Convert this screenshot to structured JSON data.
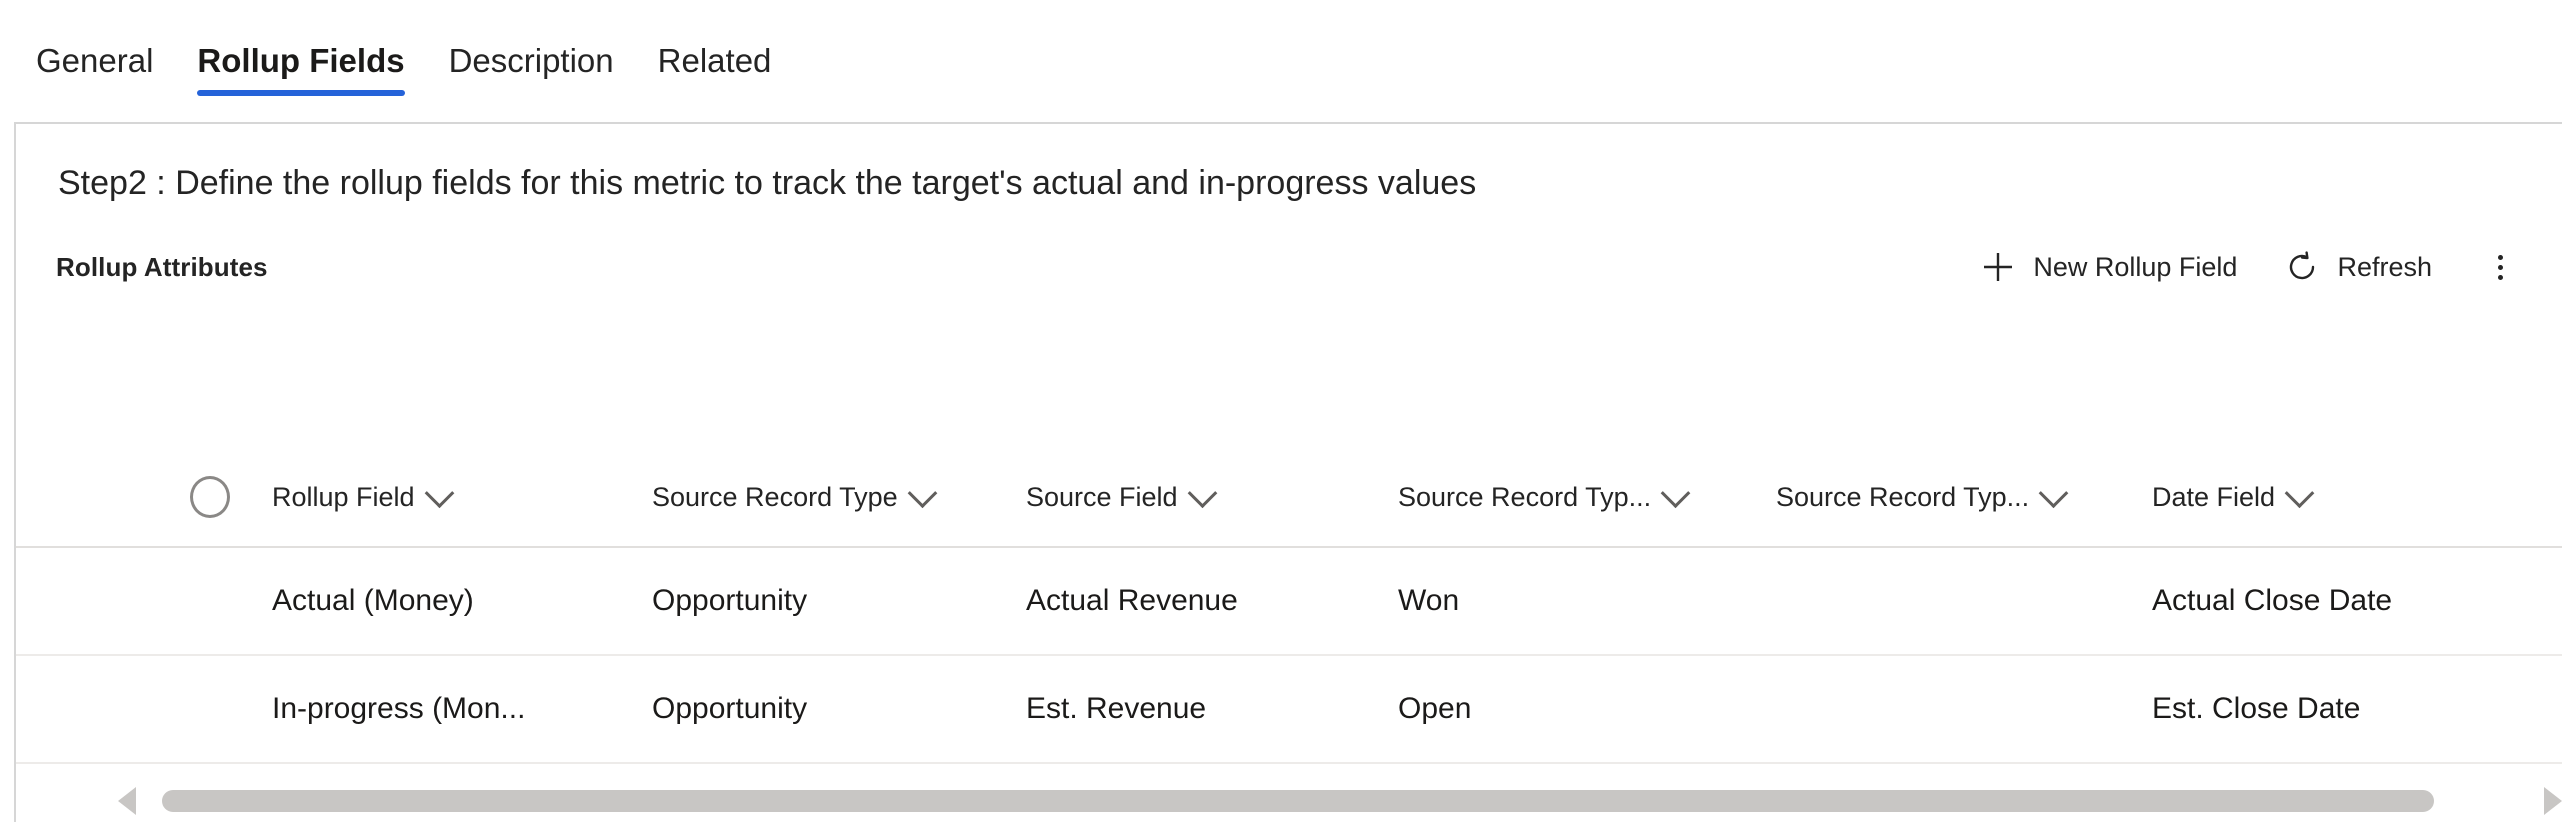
{
  "tabs": [
    {
      "label": "General",
      "active": false
    },
    {
      "label": "Rollup Fields",
      "active": true
    },
    {
      "label": "Description",
      "active": false
    },
    {
      "label": "Related",
      "active": false
    }
  ],
  "panel": {
    "step_text": "Step2 : Define the rollup fields for this metric to track the target's actual and in-progress values",
    "grid_title": "Rollup Attributes",
    "accent_color": "#2563d9",
    "toolbar": {
      "new_label": "New Rollup Field",
      "new_icon": "plus-icon",
      "refresh_label": "Refresh",
      "refresh_icon": "refresh-icon",
      "overflow_icon": "more-vertical-icon"
    },
    "grid": {
      "select_all_icon": "select-all-circle",
      "columns": [
        {
          "label": "Rollup Field",
          "sort_icon": "chevron-down-icon",
          "align": "left"
        },
        {
          "label": "Source Record Type",
          "sort_icon": "chevron-down-icon",
          "align": "left"
        },
        {
          "label": "Source Field",
          "sort_icon": "chevron-down-icon",
          "align": "left"
        },
        {
          "label": "Source Record Typ...",
          "sort_icon": "chevron-down-icon",
          "align": "left"
        },
        {
          "label": "Source Record Typ...",
          "sort_icon": "chevron-down-icon",
          "align": "left"
        },
        {
          "label": "Date Field",
          "sort_icon": "chevron-down-icon",
          "align": "left"
        }
      ],
      "rows": [
        {
          "rollup_field": "Actual (Money)",
          "source_record_type": "Opportunity",
          "source_field": "Actual Revenue",
          "source_record_type_2": "Won",
          "source_record_type_3": "",
          "date_field": "Actual Close Date"
        },
        {
          "rollup_field": "In-progress (Mon...",
          "source_record_type": "Opportunity",
          "source_field": "Est. Revenue",
          "source_record_type_2": "Open",
          "source_record_type_3": "",
          "date_field": "Est. Close Date"
        }
      ]
    },
    "scrollbar": {
      "left_arrow_icon": "scroll-left-arrow-icon",
      "right_arrow_icon": "scroll-right-arrow-icon"
    }
  }
}
